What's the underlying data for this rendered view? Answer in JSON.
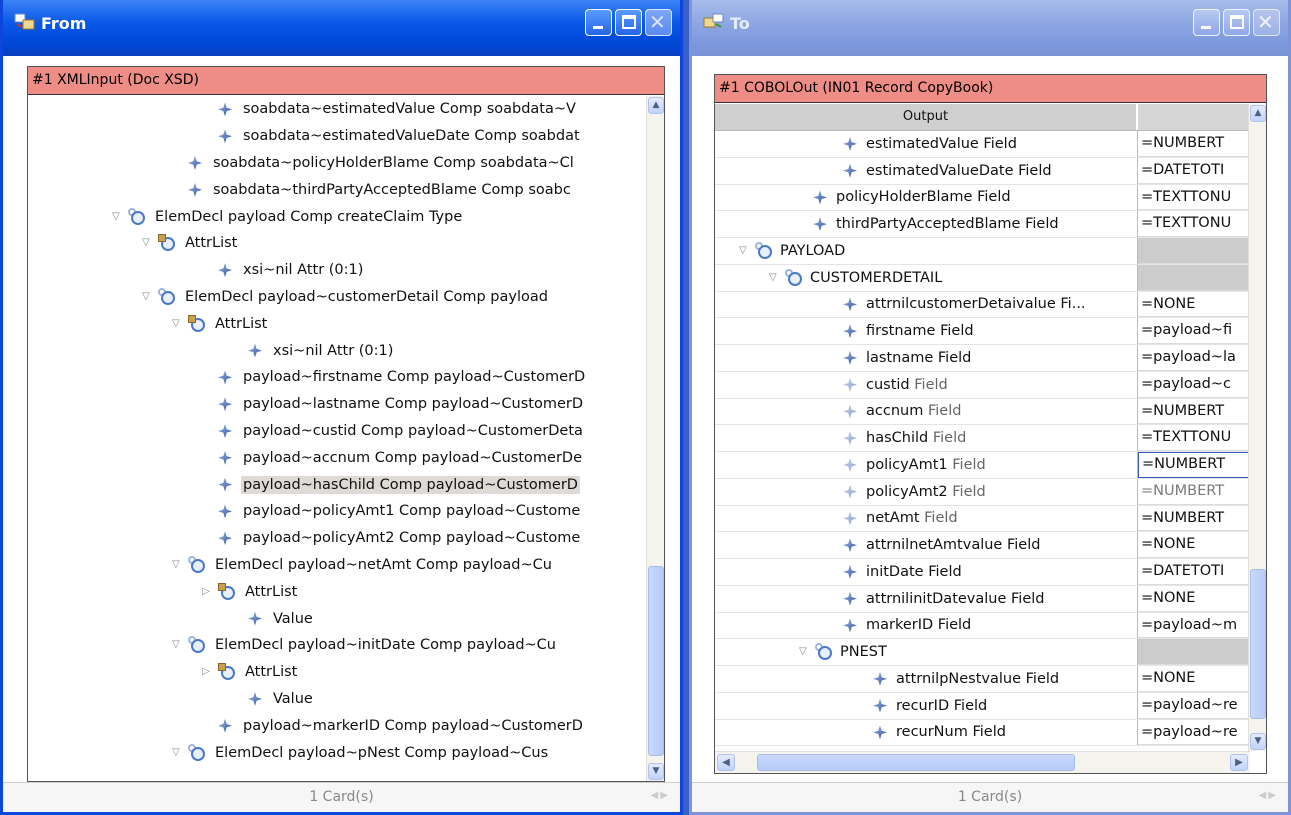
{
  "from_window": {
    "title": "From",
    "card_header": "#1 XMLInput (Doc XSD)",
    "status": "1 Card(s)",
    "tree": [
      {
        "indent": 190,
        "kind": "leaf",
        "text": "soabdata~estimatedValue Comp soabdata~V"
      },
      {
        "indent": 190,
        "kind": "leaf",
        "text": "soabdata~estimatedValueDate Comp soabdat"
      },
      {
        "indent": 160,
        "kind": "leaf",
        "text": "soabdata~policyHolderBlame Comp soabdata~Cl"
      },
      {
        "indent": 160,
        "kind": "leaf",
        "text": "soabdata~thirdPartyAcceptedBlame Comp soabc"
      },
      {
        "indent": 100,
        "kind": "node",
        "text": "ElemDecl payload Comp createClaim Type"
      },
      {
        "indent": 130,
        "kind": "attr",
        "text": "AttrList"
      },
      {
        "indent": 190,
        "kind": "leaf",
        "text": "xsi~nil Attr (0:1)"
      },
      {
        "indent": 130,
        "kind": "node",
        "text": "ElemDecl payload~customerDetail Comp payload"
      },
      {
        "indent": 160,
        "kind": "attr",
        "text": "AttrList"
      },
      {
        "indent": 220,
        "kind": "leaf",
        "text": "xsi~nil Attr (0:1)"
      },
      {
        "indent": 190,
        "kind": "leaf",
        "text": "payload~firstname Comp payload~CustomerD"
      },
      {
        "indent": 190,
        "kind": "leaf",
        "text": "payload~lastname Comp payload~CustomerD"
      },
      {
        "indent": 190,
        "kind": "leaf",
        "text": "payload~custid Comp payload~CustomerDeta"
      },
      {
        "indent": 190,
        "kind": "leaf",
        "text": "payload~accnum Comp payload~CustomerDe"
      },
      {
        "indent": 190,
        "kind": "leaf",
        "text": "payload~hasChild Comp payload~CustomerD",
        "selected": true
      },
      {
        "indent": 190,
        "kind": "leaf",
        "text": "payload~policyAmt1 Comp payload~Custome"
      },
      {
        "indent": 190,
        "kind": "leaf",
        "text": "payload~policyAmt2 Comp payload~Custome"
      },
      {
        "indent": 160,
        "kind": "node",
        "text": "ElemDecl payload~netAmt Comp payload~Cu"
      },
      {
        "indent": 190,
        "kind": "attr-collapsed",
        "text": "AttrList"
      },
      {
        "indent": 220,
        "kind": "leaf",
        "text": "Value"
      },
      {
        "indent": 160,
        "kind": "node",
        "text": "ElemDecl payload~initDate Comp payload~Cu"
      },
      {
        "indent": 190,
        "kind": "attr-collapsed",
        "text": "AttrList"
      },
      {
        "indent": 220,
        "kind": "leaf",
        "text": "Value"
      },
      {
        "indent": 190,
        "kind": "leaf",
        "text": "payload~markerID Comp payload~CustomerD"
      },
      {
        "indent": 160,
        "kind": "node",
        "text": "ElemDecl payload~pNest Comp payload~Cus"
      }
    ]
  },
  "to_window": {
    "title": "To",
    "card_header": "#1 COBOLOut (IN01 Record CopyBook)",
    "column_output": "Output",
    "status": "1 Card(s)",
    "rows": [
      {
        "indent": 128,
        "kind": "leaf",
        "name": "estimatedValue",
        "suffix": " Field",
        "value": "=NUMBERT"
      },
      {
        "indent": 128,
        "kind": "leaf",
        "name": "estimatedValueDate",
        "suffix": " Field",
        "value": "=DATETOTI"
      },
      {
        "indent": 98,
        "kind": "leaf",
        "name": "policyHolderBlame",
        "suffix": " Field",
        "value": "=TEXTTONU"
      },
      {
        "indent": 98,
        "kind": "leaf",
        "name": "thirdPartyAcceptedBlame",
        "suffix": " Field",
        "value": "=TEXTTONU"
      },
      {
        "indent": 40,
        "kind": "node",
        "name": "PAYLOAD",
        "suffix": "",
        "value": "",
        "grey": true
      },
      {
        "indent": 70,
        "kind": "node",
        "name": "CUSTOMERDETAIL",
        "suffix": "",
        "value": "",
        "grey": true
      },
      {
        "indent": 128,
        "kind": "leaf",
        "name": "attrnilcustomerDetaivalue Fi...",
        "suffix": "",
        "value": "=NONE"
      },
      {
        "indent": 128,
        "kind": "leaf",
        "name": "firstname",
        "suffix": " Field",
        "value": "=payload~fi"
      },
      {
        "indent": 128,
        "kind": "leaf",
        "name": "lastname",
        "suffix": " Field",
        "value": "=payload~la"
      },
      {
        "indent": 128,
        "kind": "leaf-dim",
        "name": "custid",
        "suffix": " Field",
        "value": "=payload~c"
      },
      {
        "indent": 128,
        "kind": "leaf-dim",
        "name": "accnum",
        "suffix": " Field",
        "value": "=NUMBERT"
      },
      {
        "indent": 128,
        "kind": "leaf-dim",
        "name": "hasChild",
        "suffix": " Field",
        "value": "=TEXTTONU"
      },
      {
        "indent": 128,
        "kind": "leaf-dim",
        "name": "policyAmt1",
        "suffix": " Field",
        "value": "=NUMBERT",
        "focus": true
      },
      {
        "indent": 128,
        "kind": "leaf-dim",
        "name": "policyAmt2",
        "suffix": " Field",
        "value": "=NUMBERT",
        "dimvalue": true
      },
      {
        "indent": 128,
        "kind": "leaf-dim",
        "name": "netAmt",
        "suffix": " Field",
        "value": "=NUMBERT"
      },
      {
        "indent": 128,
        "kind": "leaf",
        "name": "attrnilnetAmtvalue",
        "suffix": " Field",
        "value": "=NONE"
      },
      {
        "indent": 128,
        "kind": "leaf",
        "name": "initDate",
        "suffix": " Field",
        "value": "=DATETOTI"
      },
      {
        "indent": 128,
        "kind": "leaf",
        "name": "attrnilinitDatevalue",
        "suffix": " Field",
        "value": "=NONE"
      },
      {
        "indent": 128,
        "kind": "leaf",
        "name": "markerID",
        "suffix": " Field",
        "value": "=payload~m"
      },
      {
        "indent": 100,
        "kind": "node",
        "name": "PNEST",
        "suffix": "",
        "value": "",
        "grey": true
      },
      {
        "indent": 158,
        "kind": "leaf",
        "name": "attrnilpNestvalue",
        "suffix": " Field",
        "value": "=NONE"
      },
      {
        "indent": 158,
        "kind": "leaf",
        "name": "recurID",
        "suffix": " Field",
        "value": "=payload~re"
      },
      {
        "indent": 158,
        "kind": "leaf",
        "name": "recurNum",
        "suffix": " Field",
        "value": "=payload~re"
      }
    ]
  },
  "icons": {
    "tree_leaf": "diamond-field-icon",
    "tree_node": "element-circle-icon",
    "attr_list": "attribute-list-icon"
  },
  "colors": {
    "card_header_bg": "#ee8c86",
    "title_active": "#0a59e8",
    "title_inactive": "#8fa8e4",
    "selected_row": "#dedbd6"
  }
}
